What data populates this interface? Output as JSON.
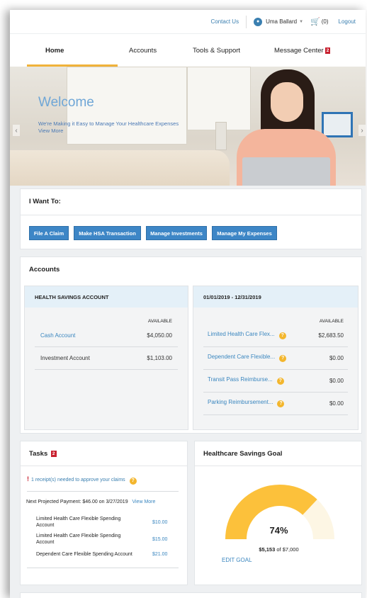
{
  "header": {
    "contact_label": "Contact Us",
    "user_name": "Uma Ballard",
    "cart_count": "(0)",
    "logout_label": "Logout"
  },
  "nav": {
    "items": [
      {
        "label": "Home"
      },
      {
        "label": "Accounts"
      },
      {
        "label": "Tools & Support"
      },
      {
        "label": "Message Center"
      }
    ],
    "message_badge": "2"
  },
  "hero": {
    "title": "Welcome",
    "subtitle": "We're Making it Easy to Manage Your Healthcare Expenses",
    "link": "View More"
  },
  "i_want_to": {
    "title": "I Want To:",
    "buttons": [
      "File A Claim",
      "Make HSA Transaction",
      "Manage Investments",
      "Manage My Expenses"
    ]
  },
  "accounts": {
    "title": "Accounts",
    "hsa": {
      "header": "HEALTH SAVINGS ACCOUNT",
      "available_label": "AVAILABLE",
      "rows": [
        {
          "name": "Cash Account",
          "amount": "$4,050.00"
        },
        {
          "name": "Investment Account",
          "amount": "$1,103.00"
        }
      ]
    },
    "fsa": {
      "header": "01/01/2019 - 12/31/2019",
      "available_label": "AVAILABLE",
      "rows": [
        {
          "name": "Limited Health Care Flex...",
          "amount": "$2,683.50"
        },
        {
          "name": "Dependent Care Flexible...",
          "amount": "$0.00"
        },
        {
          "name": "Transit Pass Reimburse...",
          "amount": "$0.00"
        },
        {
          "name": "Parking Reimbursement...",
          "amount": "$0.00"
        }
      ]
    }
  },
  "tasks": {
    "title": "Tasks",
    "badge": "2",
    "alert": "1 receipt(s) needed to approve your claims",
    "payment_text": "Next Projected Payment: $46.00 on 3/27/2019",
    "view_more": "View More",
    "items": [
      {
        "name": "Limited Health Care Flexible Spending Account",
        "amount": "$10.00"
      },
      {
        "name": "Limited Health Care Flexible Spending Account",
        "amount": "$15.00"
      },
      {
        "name": "Dependent Care Flexible Spending Account",
        "amount": "$21.00"
      }
    ]
  },
  "goal": {
    "title": "Healthcare Savings Goal",
    "percent_label": "74%",
    "percent": 0.74,
    "saved": "$5,153",
    "of_text": "of $7,000",
    "edit_label": "EDIT GOAL"
  },
  "colors": {
    "accent": "#3d86c6",
    "gauge_fill": "#fcc13b",
    "gauge_track": "#fdf6e4",
    "badge": "#c8202f",
    "nav_underline": "#f0b23a"
  }
}
